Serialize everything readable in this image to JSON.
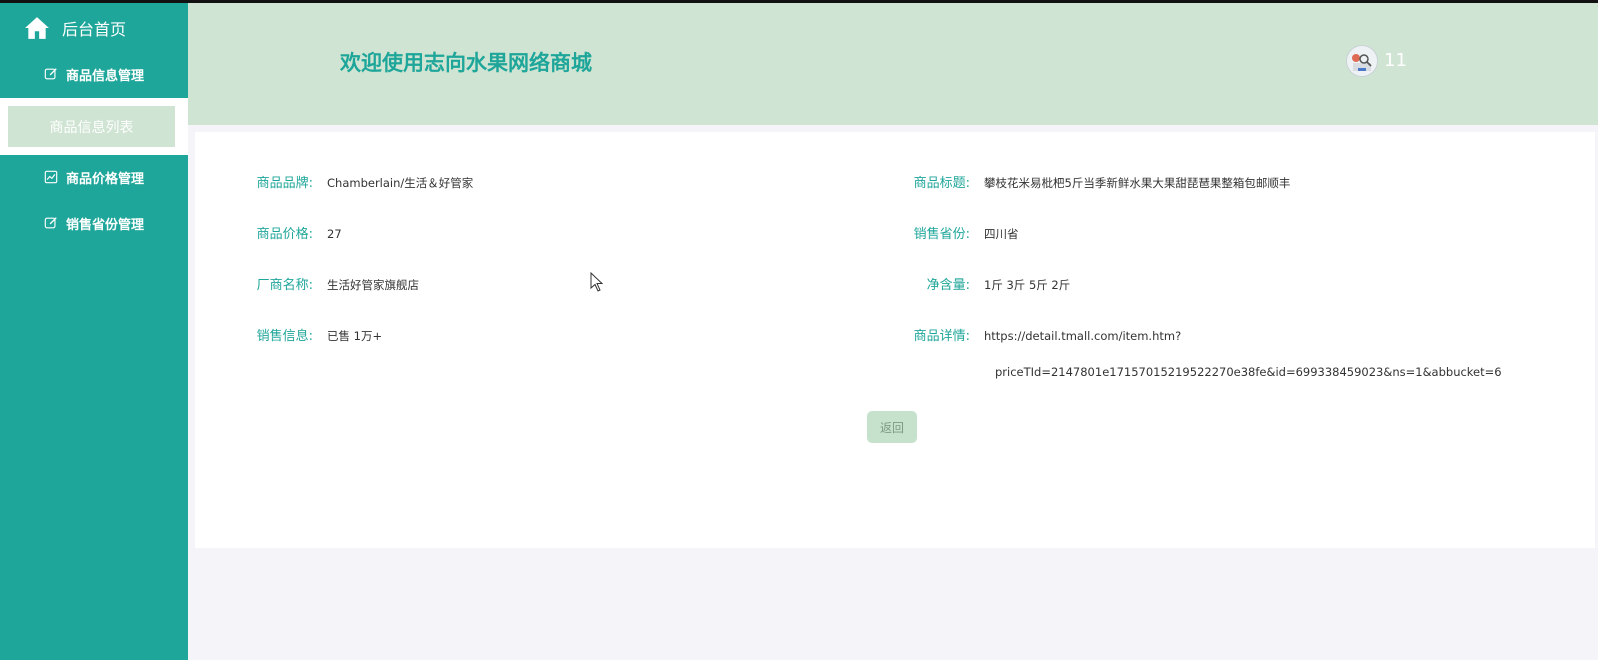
{
  "sidebar": {
    "home_label": "后台首页",
    "menu": [
      {
        "label": "商品信息管理",
        "icon": "edit-icon"
      },
      {
        "label": "商品信息列表",
        "icon": null
      },
      {
        "label": "商品价格管理",
        "icon": "chart-icon"
      },
      {
        "label": "销售省份管理",
        "icon": "edit-icon"
      }
    ]
  },
  "header": {
    "title": "欢迎使用志向水果网络商城",
    "user_number": "11"
  },
  "product": {
    "brand_label": "商品品牌:",
    "brand_value": "Chamberlain/生活＆好管家",
    "title_label": "商品标题:",
    "title_value": "攀枝花米易枇杷5斤当季新鲜水果大果甜琵琶果整箱包邮顺丰",
    "price_label": "商品价格:",
    "price_value": "27",
    "province_label": "销售省份:",
    "province_value": "四川省",
    "vendor_label": "厂商名称:",
    "vendor_value": "生活好管家旗舰店",
    "net_label": "净含量:",
    "net_value": "1斤 3斤 5斤 2斤",
    "sales_label": "销售信息:",
    "sales_value": "已售 1万+",
    "detail_label": "商品详情:",
    "detail_value_line1": "https://detail.tmall.com/item.htm?",
    "detail_value_line2": "priceTId=2147801e17157015219522270e38fe&id=699338459023&ns=1&abbucket=6"
  },
  "actions": {
    "back_label": "返回"
  },
  "colors": {
    "sidebar_bg": "#1fa69a",
    "header_bg": "#cfe4d2",
    "accent": "#1fa69a"
  }
}
